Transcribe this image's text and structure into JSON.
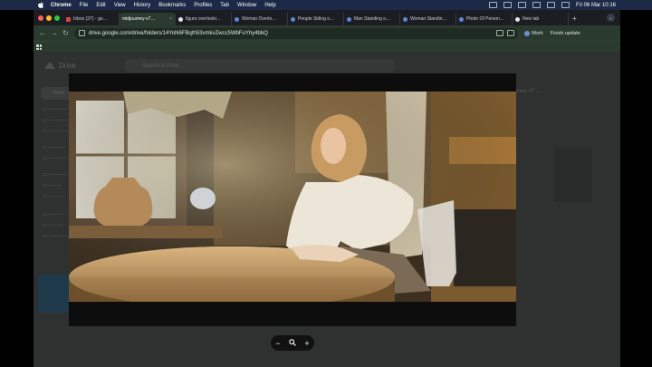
{
  "menubar": {
    "app": "Chrome",
    "items": [
      "File",
      "Edit",
      "View",
      "History",
      "Bookmarks",
      "Profiles",
      "Tab",
      "Window",
      "Help"
    ],
    "clock": "Fri 06 Mar 10:16"
  },
  "tabs": [
    {
      "title": "Inbox (37) - go…",
      "icon": "gmail-icon",
      "active": false
    },
    {
      "title": "midjourney-v7…",
      "icon": "drive-icon",
      "active": true
    },
    {
      "title": "figure overlooki…",
      "icon": "google-icon",
      "active": false
    },
    {
      "title": "Woman Overlo…",
      "icon": "globe-icon",
      "active": false
    },
    {
      "title": "People Sitting o…",
      "icon": "globe-icon",
      "active": false
    },
    {
      "title": "Man Standing o…",
      "icon": "globe-icon",
      "active": false
    },
    {
      "title": "Woman Standin…",
      "icon": "globe-icon",
      "active": false
    },
    {
      "title": "Photo Of Person…",
      "icon": "globe-icon",
      "active": false
    },
    {
      "title": "New tab",
      "icon": "google-icon",
      "active": false
    }
  ],
  "toolbar": {
    "url": "drive.google.com/drive/folders/14YoN6FBqth53vmkvZwcc5WbFuYhy4bbQ",
    "profile": "Work",
    "update": "Finish update"
  },
  "drive": {
    "brand": "Drive",
    "search_placeholder": "Search in Drive",
    "new_label": "New",
    "details_title": "midjourney‑v7 …"
  },
  "viewer": {
    "zoom_out": "−",
    "zoom_icon": "magnifier-icon",
    "zoom_in": "+"
  },
  "colors": {
    "menubar": "#1c2a48",
    "toolbar": "#2b3a2e",
    "viewer_bg": "#0c0d0c"
  }
}
